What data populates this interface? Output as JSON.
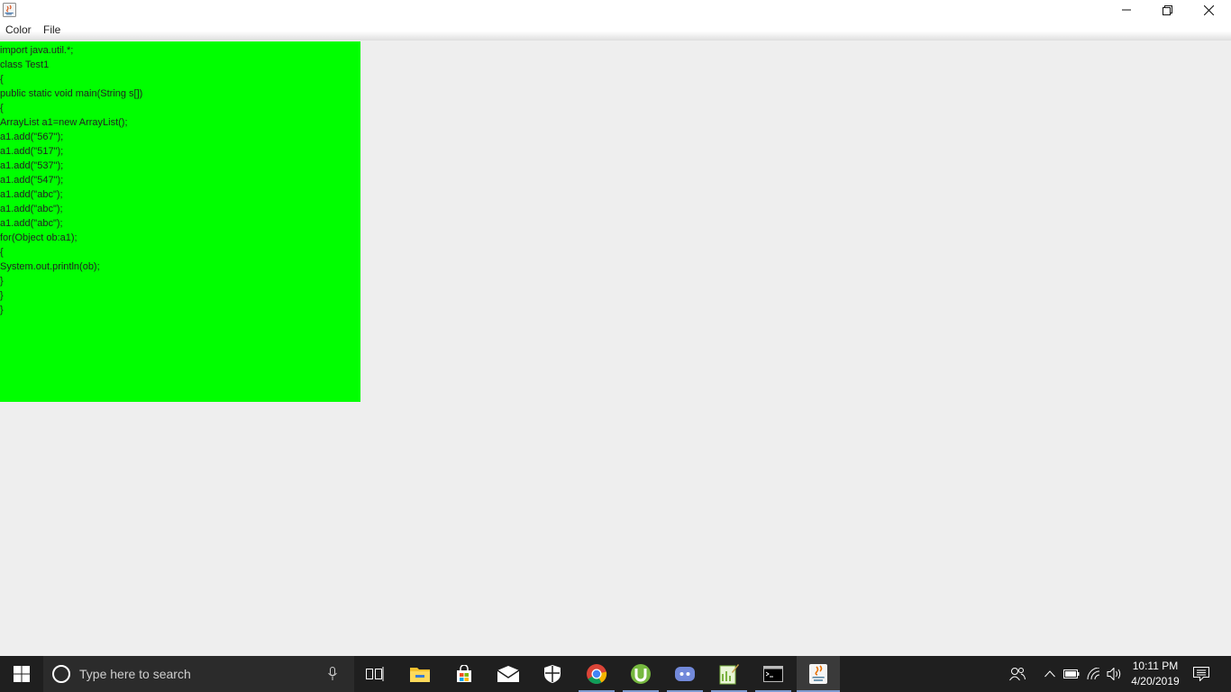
{
  "window": {
    "menu": [
      {
        "label": "Color"
      },
      {
        "label": "File"
      }
    ]
  },
  "editor": {
    "background": "#00ff00",
    "lines": [
      "import java.util.*;",
      "class Test1",
      "{",
      "public static void main(String s[])",
      "{",
      "ArrayList a1=new ArrayList();",
      "a1.add(\"567\");",
      "a1.add(\"517\");",
      "a1.add(\"537\");",
      "a1.add(\"547\");",
      "a1.add(\"abc\");",
      "a1.add(\"abc\");",
      "a1.add(\"abc\");",
      "for(Object ob:a1);",
      "{",
      "System.out.println(ob);",
      "}",
      "}",
      "}"
    ]
  },
  "taskbar": {
    "search_placeholder": "Type here to search",
    "apps": [
      "task-view",
      "file-explorer",
      "microsoft-store",
      "mail",
      "windows-security",
      "chrome",
      "utorrent",
      "discord",
      "notepad-plus",
      "command-prompt",
      "java"
    ],
    "clock_time": "10:11 PM",
    "clock_date": "4/20/2019"
  }
}
